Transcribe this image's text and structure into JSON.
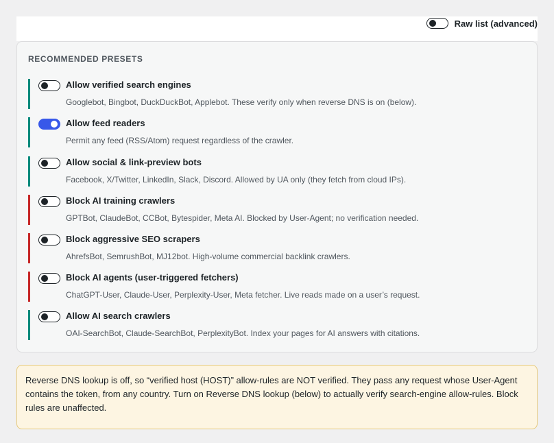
{
  "raw_toggle": {
    "label": "Raw list (advanced)",
    "on": false
  },
  "presets": {
    "title": "RECOMMENDED PRESETS",
    "items": [
      {
        "title": "Allow verified search engines",
        "desc": "Googlebot, Bingbot, DuckDuckBot, Applebot. These verify only when reverse DNS is on (below).",
        "on": false,
        "kind": "allow"
      },
      {
        "title": "Allow feed readers",
        "desc": "Permit any feed (RSS/Atom) request regardless of the crawler.",
        "on": true,
        "kind": "allow"
      },
      {
        "title": "Allow social & link-preview bots",
        "desc": "Facebook, X/Twitter, LinkedIn, Slack, Discord. Allowed by UA only (they fetch from cloud IPs).",
        "on": false,
        "kind": "allow"
      },
      {
        "title": "Block AI training crawlers",
        "desc": "GPTBot, ClaudeBot, CCBot, Bytespider, Meta AI. Blocked by User-Agent; no verification needed.",
        "on": false,
        "kind": "block"
      },
      {
        "title": "Block aggressive SEO scrapers",
        "desc": "AhrefsBot, SemrushBot, MJ12bot. High-volume commercial backlink crawlers.",
        "on": false,
        "kind": "block"
      },
      {
        "title": "Block AI agents (user-triggered fetchers)",
        "desc": "ChatGPT-User, Claude-User, Perplexity-User, Meta fetcher. Live reads made on a user’s request.",
        "on": false,
        "kind": "block"
      },
      {
        "title": "Allow AI search crawlers",
        "desc": "OAI-SearchBot, Claude-SearchBot, PerplexityBot. Index your pages for AI answers with citations.",
        "on": false,
        "kind": "allow"
      }
    ]
  },
  "notice": {
    "text": "Reverse DNS lookup is off, so “verified host (HOST)” allow-rules are NOT verified. They pass any request whose User-Agent contains the token, from any country. Turn on Reverse DNS lookup (below) to actually verify search-engine allow-rules. Block rules are unaffected."
  },
  "colors": {
    "allow_accent": "#00897b",
    "block_accent": "#c62828",
    "toggle_on": "#3858e9",
    "notice_bg": "#fdf5e2",
    "notice_border": "#e6c97a"
  }
}
